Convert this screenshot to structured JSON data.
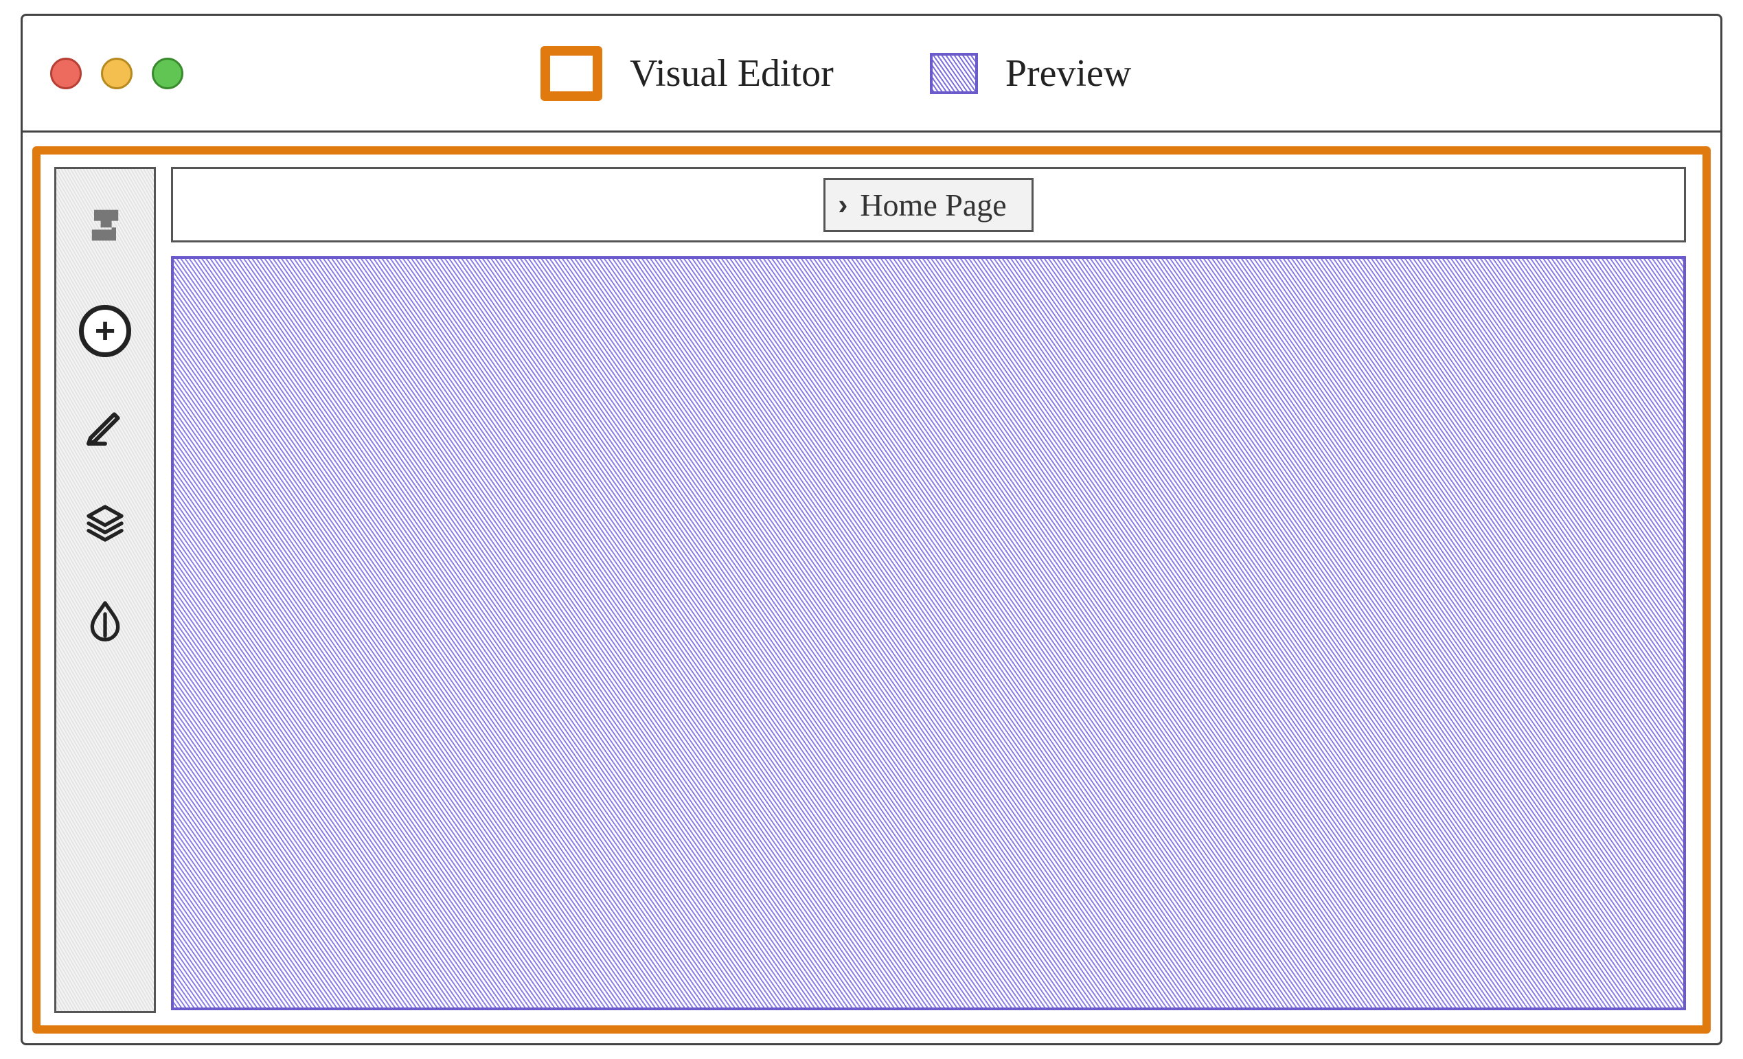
{
  "legend": {
    "visual_editor_label": "Visual Editor",
    "preview_label": "Preview",
    "editor_color": "#e17a0e",
    "preview_color": "#6a5acb"
  },
  "traffic_lights": {
    "close_color": "#ed6a5e",
    "minimize_color": "#f5bf4f",
    "zoom_color": "#61c554"
  },
  "breadcrumb": {
    "current_page": "Home Page"
  },
  "sidebar": {
    "logo_icon": "logo-s",
    "tools": [
      {
        "name": "add",
        "icon": "plus-circle"
      },
      {
        "name": "edit",
        "icon": "pencil"
      },
      {
        "name": "layers",
        "icon": "layers"
      },
      {
        "name": "theme",
        "icon": "droplet"
      }
    ]
  }
}
